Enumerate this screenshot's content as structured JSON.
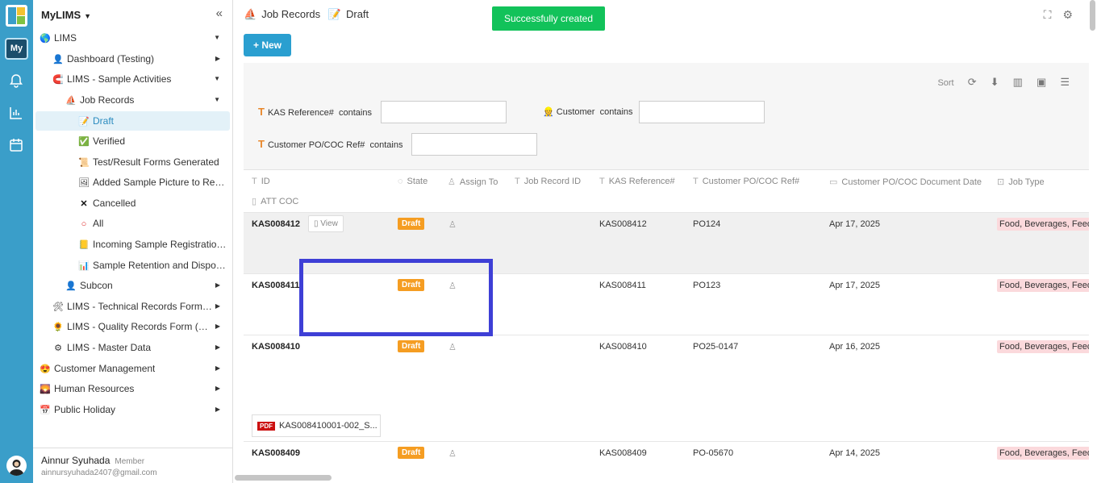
{
  "rail": {
    "my_label": "My"
  },
  "sidebar": {
    "app_title": "MyLIMS",
    "collapse_icon": "«",
    "items": [
      {
        "label": "LIMS",
        "icon": "🌎",
        "arrow": "▼"
      },
      {
        "label": "Dashboard (Testing)",
        "icon": "👤",
        "arrow": "▶"
      },
      {
        "label": "LIMS - Sample Activities",
        "icon": "🧲",
        "arrow": "▼"
      },
      {
        "label": "Job Records",
        "icon": "⛵",
        "arrow": "▼"
      },
      {
        "label": "Draft",
        "icon": "📝",
        "arrow": ""
      },
      {
        "label": "Verified",
        "icon": "✅",
        "arrow": ""
      },
      {
        "label": "Test/Result Forms Generated",
        "icon": "📜",
        "arrow": ""
      },
      {
        "label": "Added Sample Picture to Repor...",
        "icon": "🖼",
        "arrow": ""
      },
      {
        "label": "Cancelled",
        "icon": "✕",
        "arrow": ""
      },
      {
        "label": "All",
        "icon": "○",
        "arrow": ""
      },
      {
        "label": "Incoming Sample Registration ...",
        "icon": "📒",
        "arrow": ""
      },
      {
        "label": "Sample Retention and Disposal...",
        "icon": "📊",
        "arrow": ""
      },
      {
        "label": "Subcon",
        "icon": "👤",
        "arrow": "▶"
      },
      {
        "label": "LIMS - Technical Records Form (T...",
        "icon": "🛠",
        "arrow": "▶"
      },
      {
        "label": "LIMS - Quality Records Form (QRF)",
        "icon": "🌻",
        "arrow": "▶"
      },
      {
        "label": "LIMS - Master Data",
        "icon": "⚙",
        "arrow": "▶"
      },
      {
        "label": "Customer Management",
        "icon": "😍",
        "arrow": "▶"
      },
      {
        "label": "Human Resources",
        "icon": "🌄",
        "arrow": "▶"
      },
      {
        "label": "Public Holiday",
        "icon": "📅",
        "arrow": "▶"
      }
    ],
    "user_name": "Ainnur Syuhada",
    "user_role": "Member",
    "user_email": "ainnursyuhada2407@gmail.com"
  },
  "header": {
    "crumb1": "Job Records",
    "crumb2": "Draft",
    "toast": "Successfully created",
    "new_button": "+ New"
  },
  "toolbar": {
    "sort_label": "Sort"
  },
  "filters": {
    "kas_label": "KAS Reference#",
    "customer_label": "Customer",
    "po_label": "Customer PO/COC Ref#",
    "op": "contains",
    "kas_value": "",
    "customer_value": "",
    "po_value": ""
  },
  "columns": [
    "ID",
    "State",
    "Assign To",
    "Job Record ID",
    "KAS Reference#",
    "Customer PO/COC Ref#",
    "Customer PO/COC Document Date",
    "Job Type",
    "ATT COC"
  ],
  "rows": [
    {
      "id": "KAS008412",
      "state": "Draft",
      "kas": "KAS008412",
      "po": "PO124",
      "date": "Apr 17, 2025",
      "job_type": "Food, Beverages, Feed",
      "view": "View",
      "attachment": ""
    },
    {
      "id": "KAS008411",
      "state": "Draft",
      "kas": "KAS008411",
      "po": "PO123",
      "date": "Apr 17, 2025",
      "job_type": "Food, Beverages, Feed",
      "view": "",
      "attachment": ""
    },
    {
      "id": "KAS008410",
      "state": "Draft",
      "kas": "KAS008410",
      "po": "PO25-0147",
      "date": "Apr 16, 2025",
      "job_type": "Food, Beverages, Feed",
      "view": "",
      "attachment": "KAS008410001-002_S..."
    },
    {
      "id": "KAS008409",
      "state": "Draft",
      "kas": "KAS008409",
      "po": "PO-05670",
      "date": "Apr 14, 2025",
      "job_type": "Food, Beverages, Feed",
      "view": "",
      "attachment": ""
    }
  ]
}
